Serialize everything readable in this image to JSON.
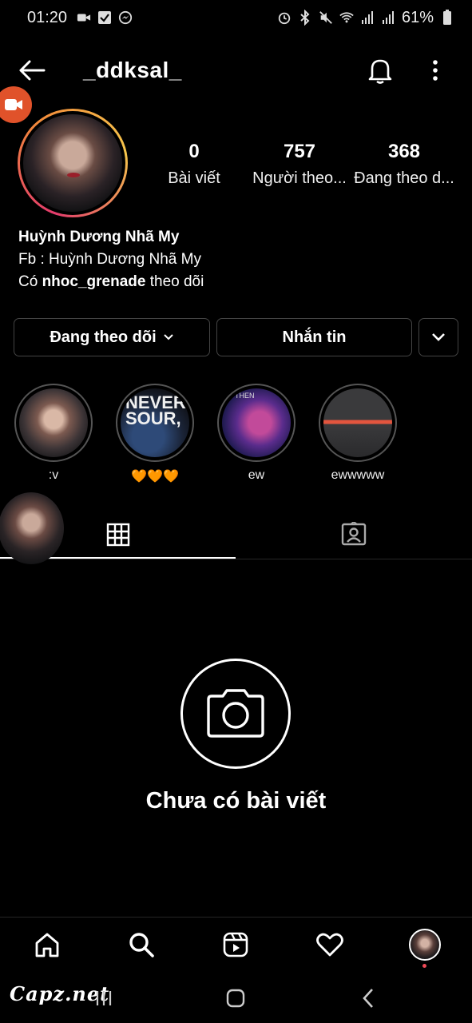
{
  "status_bar": {
    "time": "01:20",
    "battery": "61%",
    "icons_left": [
      "video-icon",
      "checkbox-icon",
      "messenger-icon"
    ],
    "icons_right": [
      "alarm-icon",
      "bluetooth-icon",
      "mute-icon",
      "wifi-icon",
      "signal-icon",
      "signal-icon",
      "battery-icon"
    ]
  },
  "header": {
    "username": "_ddksal_"
  },
  "profile": {
    "stats": [
      {
        "value": "0",
        "label": "Bài viết"
      },
      {
        "value": "757",
        "label": "Người theo..."
      },
      {
        "value": "368",
        "label": "Đang theo d..."
      }
    ],
    "bio": {
      "name": "Huỳnh Dương Nhã My",
      "line1": "Fb : Huỳnh Dương Nhã My",
      "followed_prefix": "Có",
      "followed_user": "nhoc_grenade",
      "followed_suffix": "theo dõi"
    }
  },
  "actions": {
    "following_label": "Đang theo dõi",
    "message_label": "Nhắn tin"
  },
  "highlights": [
    {
      "label": ":v",
      "overlay": ""
    },
    {
      "label": "🧡🧡🧡",
      "overlay": "NEVER SOUR,"
    },
    {
      "label": "ew",
      "overlay": "THEN"
    },
    {
      "label": "ewwwww",
      "overlay": ""
    }
  ],
  "empty_state": {
    "text": "Chưa có bài viết"
  },
  "watermark": "Capz.net",
  "colors": {
    "background": "#000000",
    "divider": "#262626",
    "live_badge": "#e0522a",
    "notification_dot": "#ed4956"
  }
}
